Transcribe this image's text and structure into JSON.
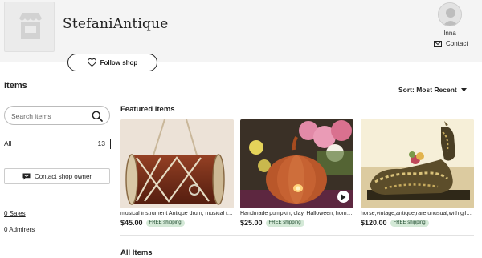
{
  "shop": {
    "name": "StefaniAntique",
    "logo_icon": "storefront-icon",
    "follow_label": "Follow shop"
  },
  "owner": {
    "name": "Inna",
    "contact_label": "Contact"
  },
  "sidebar": {
    "title": "Items",
    "search_placeholder": "Search items",
    "categories": [
      {
        "label": "All",
        "count": "13"
      }
    ],
    "contact_owner_label": "Contact shop owner",
    "sales_label": "0 Sales",
    "admirers_label": "0 Admirers"
  },
  "sort": {
    "label": "Sort: Most Recent"
  },
  "featured": {
    "title": "Featured items",
    "items": [
      {
        "title": "musical instrument Antique drum, musical instrument, folk drum",
        "price": "$45.00",
        "badge": "FREE shipping"
      },
      {
        "title": "Handmade pumpkin, clay, Halloween, home decor",
        "price": "$25.00",
        "badge": "FREE shipping",
        "has_video": true
      },
      {
        "title": "horse,vintage,antique,rare,unusual,with gilding",
        "price": "$120.00",
        "badge": "FREE shipping"
      }
    ]
  },
  "all_items": {
    "title": "All Items"
  },
  "colors": {
    "header_bg": "#f4f4f4",
    "badge_bg": "#d4e9d7",
    "badge_text": "#1f4a2e",
    "text": "#222222"
  }
}
